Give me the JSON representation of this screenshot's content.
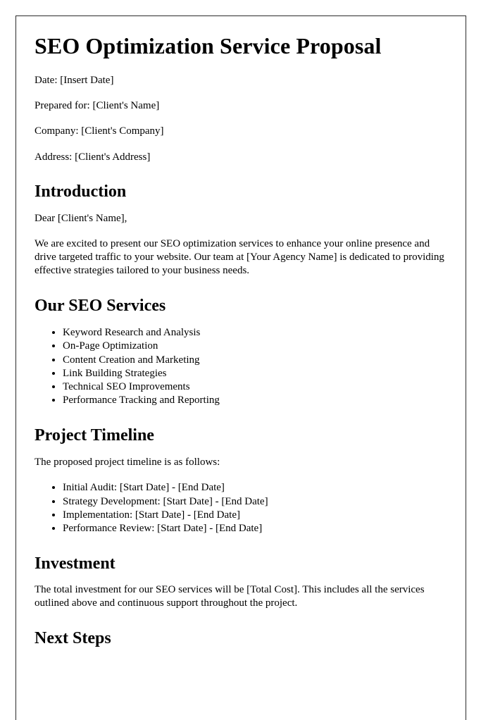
{
  "document": {
    "title": "SEO Optimization Service Proposal",
    "meta_lines": [
      "Date: [Insert Date]",
      "Prepared for: [Client's Name]",
      "Company: [Client's Company]",
      "Address: [Client's Address]"
    ],
    "sections": {
      "introduction": {
        "heading": "Introduction",
        "salutation": "Dear [Client's Name],",
        "paragraph": "We are excited to present our SEO optimization services to enhance your online presence and drive targeted traffic to your website. Our team at [Your Agency Name] is dedicated to providing effective strategies tailored to your business needs."
      },
      "services": {
        "heading": "Our SEO Services",
        "items": [
          "Keyword Research and Analysis",
          "On-Page Optimization",
          "Content Creation and Marketing",
          "Link Building Strategies",
          "Technical SEO Improvements",
          "Performance Tracking and Reporting"
        ]
      },
      "timeline": {
        "heading": "Project Timeline",
        "lead": "The proposed project timeline is as follows:",
        "items": [
          "Initial Audit: [Start Date] - [End Date]",
          "Strategy Development: [Start Date] - [End Date]",
          "Implementation: [Start Date] - [End Date]",
          "Performance Review: [Start Date] - [End Date]"
        ]
      },
      "investment": {
        "heading": "Investment",
        "paragraph": "The total investment for our SEO services will be [Total Cost]. This includes all the services outlined above and continuous support throughout the project."
      },
      "next_steps": {
        "heading": "Next Steps"
      }
    },
    "colors": {
      "page_background": "#ffffff",
      "text": "#000000",
      "page_border": "#2b2b2b"
    }
  }
}
